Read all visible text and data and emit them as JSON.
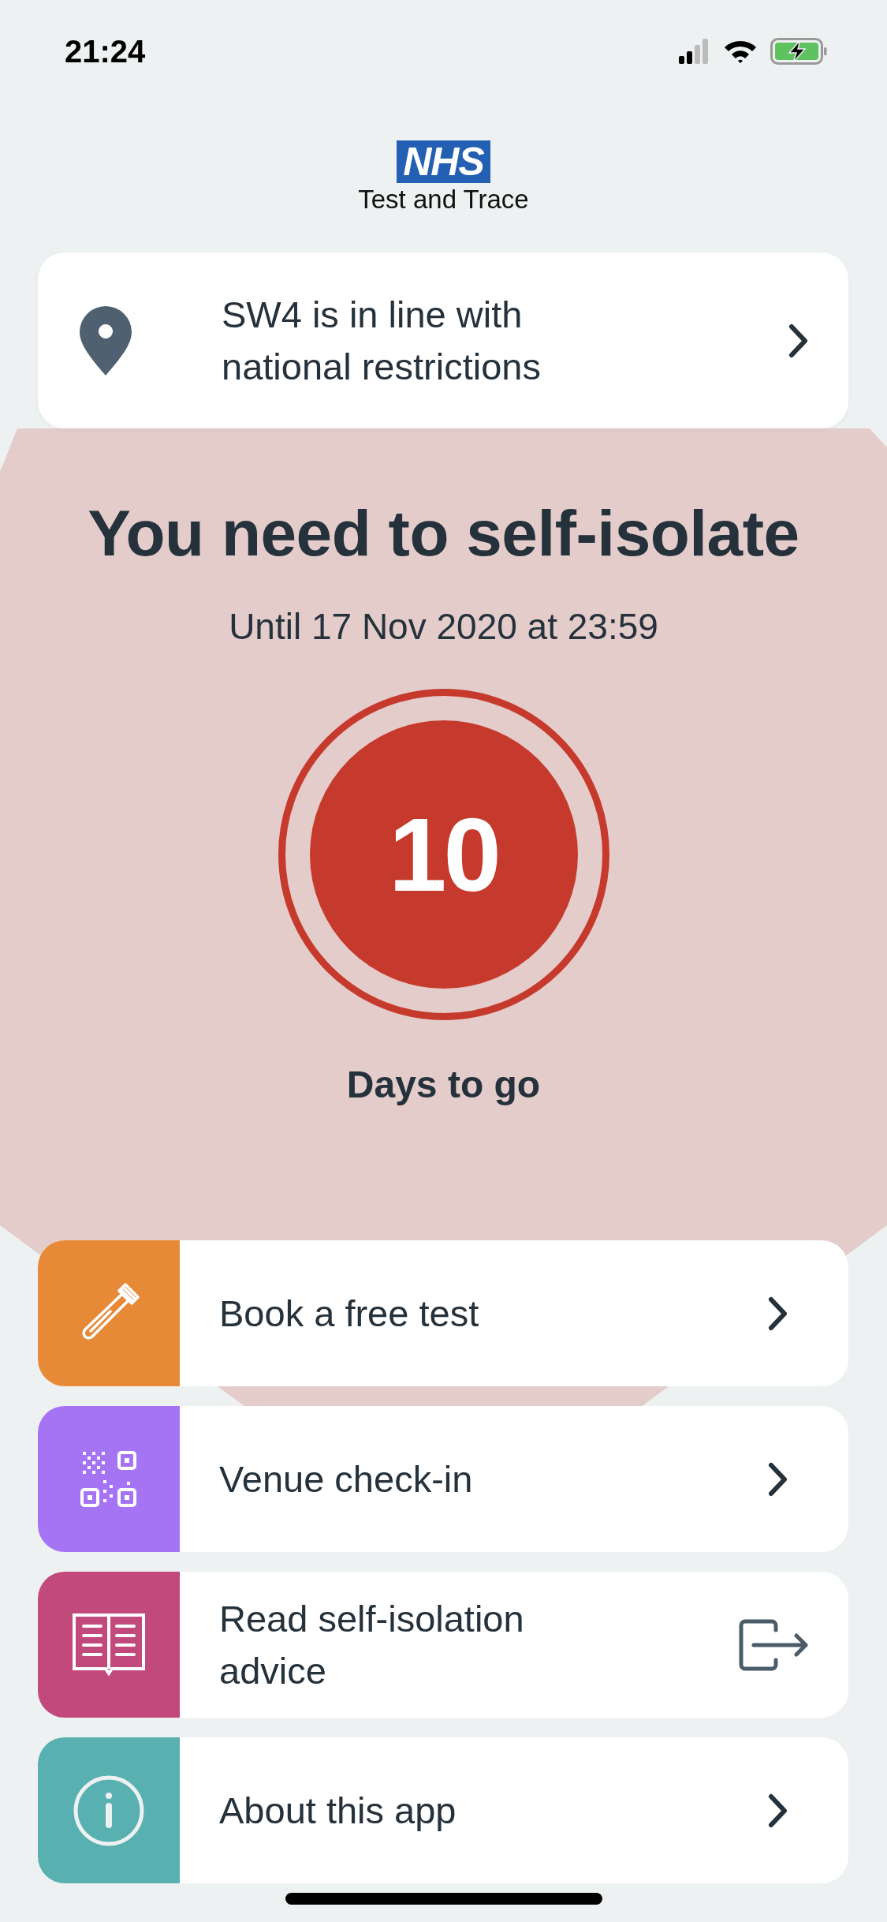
{
  "status_bar": {
    "time": "21:24"
  },
  "header": {
    "logo": "NHS",
    "subtitle": "Test and Trace"
  },
  "location_card": {
    "text": "SW4 is in line with national restrictions"
  },
  "isolation": {
    "title": "You need to self-isolate",
    "until": "Until 17 Nov 2020 at 23:59",
    "days": "10",
    "days_label": "Days to go"
  },
  "menu": [
    {
      "label": "Book a free test",
      "color": "#e68a37",
      "kind": "chevron"
    },
    {
      "label": "Venue check-in",
      "color": "#a574f4",
      "kind": "chevron"
    },
    {
      "label": "Read self-isolation advice",
      "color": "#c2497b",
      "kind": "external"
    },
    {
      "label": "About this app",
      "color": "#58b0b0",
      "kind": "chevron"
    }
  ]
}
